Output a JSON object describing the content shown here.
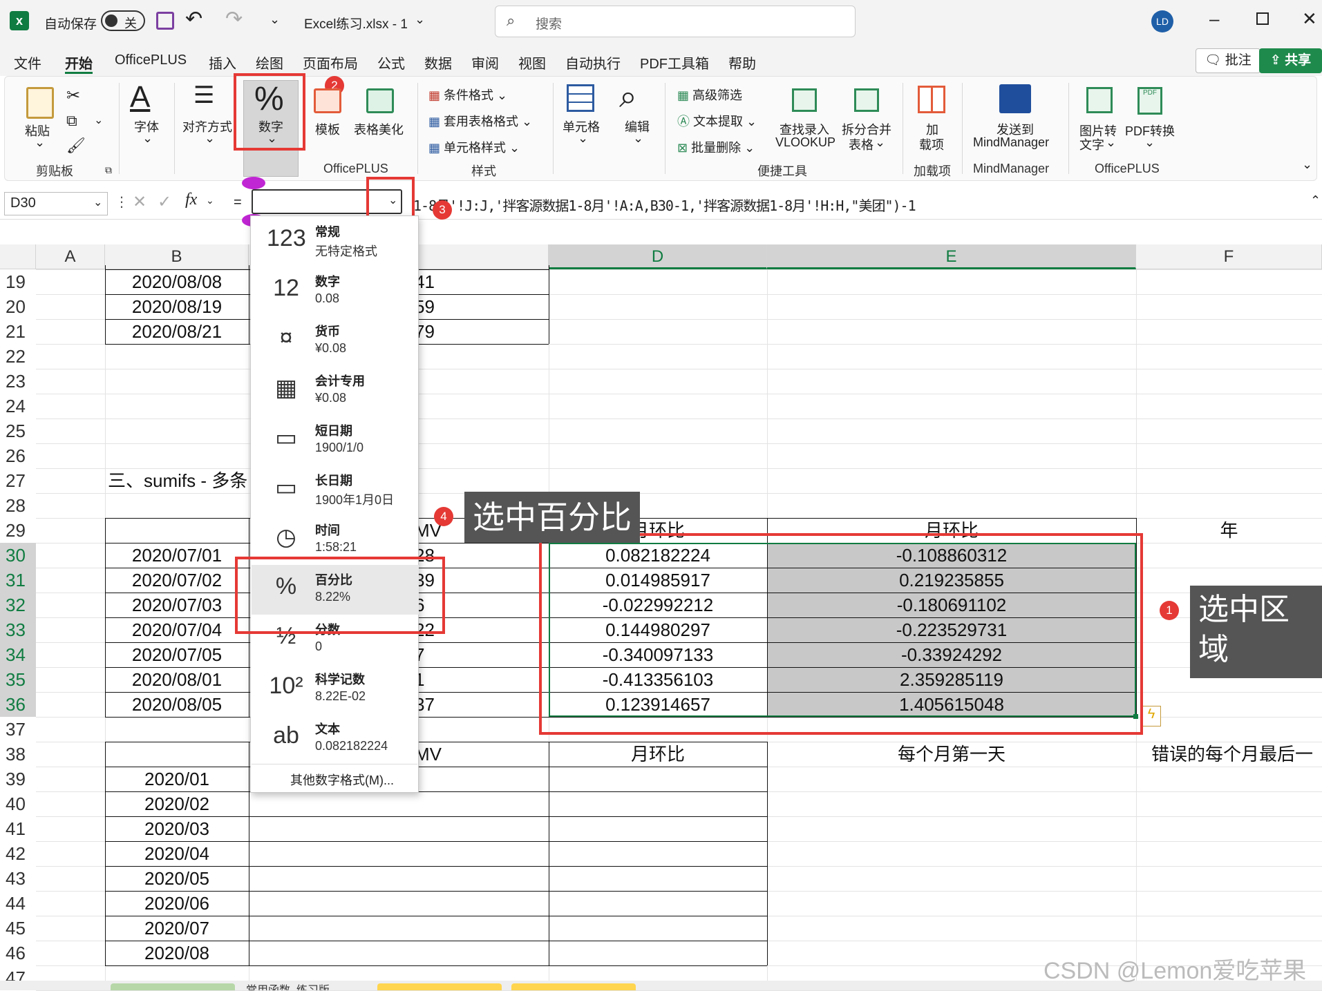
{
  "titlebar": {
    "autosave_label": "自动保存",
    "autosave_state": "关",
    "filename": "Excel练习.xlsx  -  1",
    "search_placeholder": "搜索",
    "user_initials": "LD"
  },
  "menu_tabs": [
    "文件",
    "开始",
    "OfficePLUS",
    "插入",
    "绘图",
    "页面布局",
    "公式",
    "数据",
    "审阅",
    "视图",
    "自动执行",
    "PDF工具箱",
    "帮助"
  ],
  "menu_right": {
    "comments": "批注",
    "share": "共享"
  },
  "ribbon": {
    "paste": "粘贴",
    "clipboard_group": "剪贴板",
    "font": "字体",
    "align": "对齐方式",
    "number": "数字",
    "template": "模板",
    "table_beautify": "表格美化",
    "officeplus_group": "OfficePLUS",
    "cond_format": "条件格式",
    "table_format": "套用表格格式",
    "cell_style": "单元格样式",
    "style_group": "样式",
    "cells": "单元格",
    "edit": "编辑",
    "adv_filter": "高级筛选",
    "text_extract": "文本提取",
    "batch_delete": "批量删除",
    "lookup_l1": "查找录入",
    "lookup_l2": "VLOOKUP",
    "split_l1": "拆分合并",
    "split_l2": "表格",
    "quick_group": "便捷工具",
    "addin_l1": "加",
    "addin_l2": "载项",
    "addin_group": "加载项",
    "mm_l1": "发送到",
    "mm_l2": "MindManager",
    "mm_group": "MindManager",
    "img_l1": "图片转",
    "img_l2": "文字",
    "pdf_conv": "PDF转换",
    "officeplus_group2": "OfficePLUS"
  },
  "formula_bar": {
    "name_box": "D30",
    "fx": "fx",
    "eq": "=",
    "formula_tail": "1-8月'!J:J,'拌客源数据1-8月'!A:A,B30-1,'拌客源数据1-8月'!H:H,\"美团\")-1"
  },
  "columns": [
    "A",
    "B",
    "D",
    "E",
    "F"
  ],
  "rows": [
    "19",
    "20",
    "21",
    "22",
    "23",
    "24",
    "25",
    "26",
    "27",
    "28",
    "29",
    "30",
    "31",
    "32",
    "33",
    "34",
    "35",
    "36",
    "37",
    "38",
    "39",
    "40",
    "41",
    "42",
    "43",
    "44",
    "45",
    "46",
    "47"
  ],
  "cells": {
    "b19": "2020/08/08",
    "b20": "2020/08/19",
    "b21": "2020/08/21",
    "c19": "41",
    "c20": "59",
    "c21": "79",
    "b27": "三、sumifs - 多条",
    "c29": "MV",
    "d29": "月环比",
    "e29": "月环比",
    "f29": "年",
    "b30": "2020/07/01",
    "b31": "2020/07/02",
    "b32": "2020/07/03",
    "b33": "2020/07/04",
    "b34": "2020/07/05",
    "b35": "2020/08/01",
    "b36": "2020/08/05",
    "c30": "28",
    "c31": "39",
    "c32": "6",
    "c33": "22",
    "c34": "7",
    "c35": "1",
    "c36": "37",
    "d30": "0.082182224",
    "d31": "0.014985917",
    "d32": "-0.022992212",
    "d33": "0.144980297",
    "d34": "-0.340097133",
    "d35": "-0.413356103",
    "d36": "0.123914657",
    "e30": "-0.108860312",
    "e31": "0.219235855",
    "e32": "-0.180691102",
    "e33": "-0.223529731",
    "e34": "-0.33924292",
    "e35": "2.359285119",
    "e36": "1.405615048",
    "c38": "MV",
    "d38": "月环比",
    "e38": "每个月第一天",
    "f38": "错误的每个月最后一",
    "b39": "2020/01",
    "b40": "2020/02",
    "b41": "2020/03",
    "b42": "2020/04",
    "b43": "2020/05",
    "b44": "2020/06",
    "b45": "2020/07",
    "b46": "2020/08"
  },
  "dropdown": {
    "items": [
      {
        "icon": "123",
        "title": "常规",
        "sample": "无特定格式"
      },
      {
        "icon": "12",
        "title": "数字",
        "sample": "0.08"
      },
      {
        "icon": "¤",
        "title": "货币",
        "sample": "¥0.08"
      },
      {
        "icon": "▦",
        "title": "会计专用",
        "sample": " ¥0.08"
      },
      {
        "icon": "▭",
        "title": "短日期",
        "sample": "1900/1/0"
      },
      {
        "icon": "▭",
        "title": "长日期",
        "sample": "1900年1月0日"
      },
      {
        "icon": "◷",
        "title": "时间",
        "sample": "1:58:21"
      },
      {
        "icon": "%",
        "title": "百分比",
        "sample": "8.22%"
      },
      {
        "icon": "½",
        "title": "分数",
        "sample": "0"
      },
      {
        "icon": "10²",
        "title": "科学记数",
        "sample": "8.22E-02"
      },
      {
        "icon": "ab",
        "title": "文本",
        "sample": "0.082182224"
      }
    ],
    "more": "其他数字格式(M)..."
  },
  "annotations": {
    "b1": "1",
    "b2": "2",
    "b3": "3",
    "b4": "4",
    "c1": "选中区\n域",
    "c4": "选中百分比"
  },
  "sheet_tabs": [
    "常用函数_练习版"
  ],
  "watermark": "CSDN @Lemon爱吃苹果",
  "colors": {
    "excel_green": "#107c41",
    "accent_red": "#e53935",
    "selection_gray": "#c8c8c8",
    "callout_bg": "#555555"
  }
}
